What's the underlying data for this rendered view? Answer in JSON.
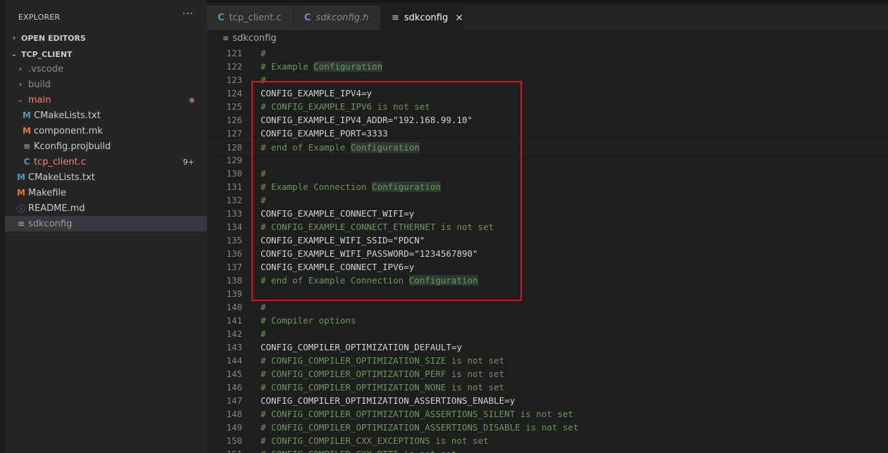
{
  "sidebar": {
    "title": "EXPLORER",
    "more_actions": "···",
    "open_editors": "OPEN EDITORS",
    "project": "TCP_CLIENT",
    "items": [
      {
        "name": ".vscode",
        "kind": "folder"
      },
      {
        "name": "build",
        "kind": "folder"
      },
      {
        "name": "main",
        "kind": "folder-open"
      },
      {
        "name": "CMakeLists.txt",
        "kind": "cmake"
      },
      {
        "name": "component.mk",
        "kind": "make"
      },
      {
        "name": "Kconfig.projbuild",
        "kind": "lines"
      },
      {
        "name": "tcp_client.c",
        "kind": "c",
        "badge": "9+"
      },
      {
        "name": "CMakeLists.txt",
        "kind": "cmake"
      },
      {
        "name": "Makefile",
        "kind": "make"
      },
      {
        "name": "README.md",
        "kind": "info"
      },
      {
        "name": "sdkconfig",
        "kind": "lines"
      }
    ],
    "icons": {
      "cmake": "M",
      "make": "M",
      "c": "C",
      "info": "ⓘ",
      "lines": "≡",
      "chevron_right": "›",
      "chevron_down": "⌄"
    }
  },
  "tabs": [
    {
      "label": "tcp_client.c",
      "icon": "C"
    },
    {
      "label": "sdkconfig.h",
      "icon": "C"
    },
    {
      "label": "sdkconfig",
      "icon": "≡",
      "close": "✕"
    }
  ],
  "breadcrumb": {
    "label": "sdkconfig",
    "icon": "≡"
  },
  "editor": {
    "highlight_word": "Configuration",
    "lines": [
      {
        "n": "121",
        "t": "#"
      },
      {
        "n": "122",
        "t": "# Example Configuration"
      },
      {
        "n": "123",
        "t": "#"
      },
      {
        "n": "124",
        "t": "CONFIG_EXAMPLE_IPV4=y"
      },
      {
        "n": "125",
        "t": "# CONFIG_EXAMPLE_IPV6 is not set"
      },
      {
        "n": "126",
        "t": "CONFIG_EXAMPLE_IPV4_ADDR=\"192.168.99.10\""
      },
      {
        "n": "127",
        "t": "CONFIG_EXAMPLE_PORT=3333"
      },
      {
        "n": "128",
        "t": "# end of Example Configuration"
      },
      {
        "n": "129",
        "t": ""
      },
      {
        "n": "130",
        "t": "#"
      },
      {
        "n": "131",
        "t": "# Example Connection Configuration"
      },
      {
        "n": "132",
        "t": "#"
      },
      {
        "n": "133",
        "t": "CONFIG_EXAMPLE_CONNECT_WIFI=y"
      },
      {
        "n": "134",
        "t": "# CONFIG_EXAMPLE_CONNECT_ETHERNET is not set"
      },
      {
        "n": "135",
        "t": "CONFIG_EXAMPLE_WIFI_SSID=\"PDCN\""
      },
      {
        "n": "136",
        "t": "CONFIG_EXAMPLE_WIFI_PASSWORD=\"1234567890\""
      },
      {
        "n": "137",
        "t": "CONFIG_EXAMPLE_CONNECT_IPV6=y"
      },
      {
        "n": "138",
        "t": "# end of Example Connection Configuration"
      },
      {
        "n": "139",
        "t": ""
      },
      {
        "n": "140",
        "t": "#"
      },
      {
        "n": "141",
        "t": "# Compiler options"
      },
      {
        "n": "142",
        "t": "#"
      },
      {
        "n": "143",
        "t": "CONFIG_COMPILER_OPTIMIZATION_DEFAULT=y"
      },
      {
        "n": "144",
        "t": "# CONFIG_COMPILER_OPTIMIZATION_SIZE is not set"
      },
      {
        "n": "145",
        "t": "# CONFIG_COMPILER_OPTIMIZATION_PERF is not set"
      },
      {
        "n": "146",
        "t": "# CONFIG_COMPILER_OPTIMIZATION_NONE is not set"
      },
      {
        "n": "147",
        "t": "CONFIG_COMPILER_OPTIMIZATION_ASSERTIONS_ENABLE=y"
      },
      {
        "n": "148",
        "t": "# CONFIG_COMPILER_OPTIMIZATION_ASSERTIONS_SILENT is not set"
      },
      {
        "n": "149",
        "t": "# CONFIG_COMPILER_OPTIMIZATION_ASSERTIONS_DISABLE is not set"
      },
      {
        "n": "150",
        "t": "# CONFIG_COMPILER_CXX_EXCEPTIONS is not set"
      },
      {
        "n": "151",
        "t": "# CONFIG_COMPILER_CXX_RTTI is not set"
      }
    ]
  },
  "colors": {
    "annotation_box": "#d7141a",
    "comment": "#6a9955",
    "text": "#d4d4d4",
    "modified": "#e2c08d"
  }
}
